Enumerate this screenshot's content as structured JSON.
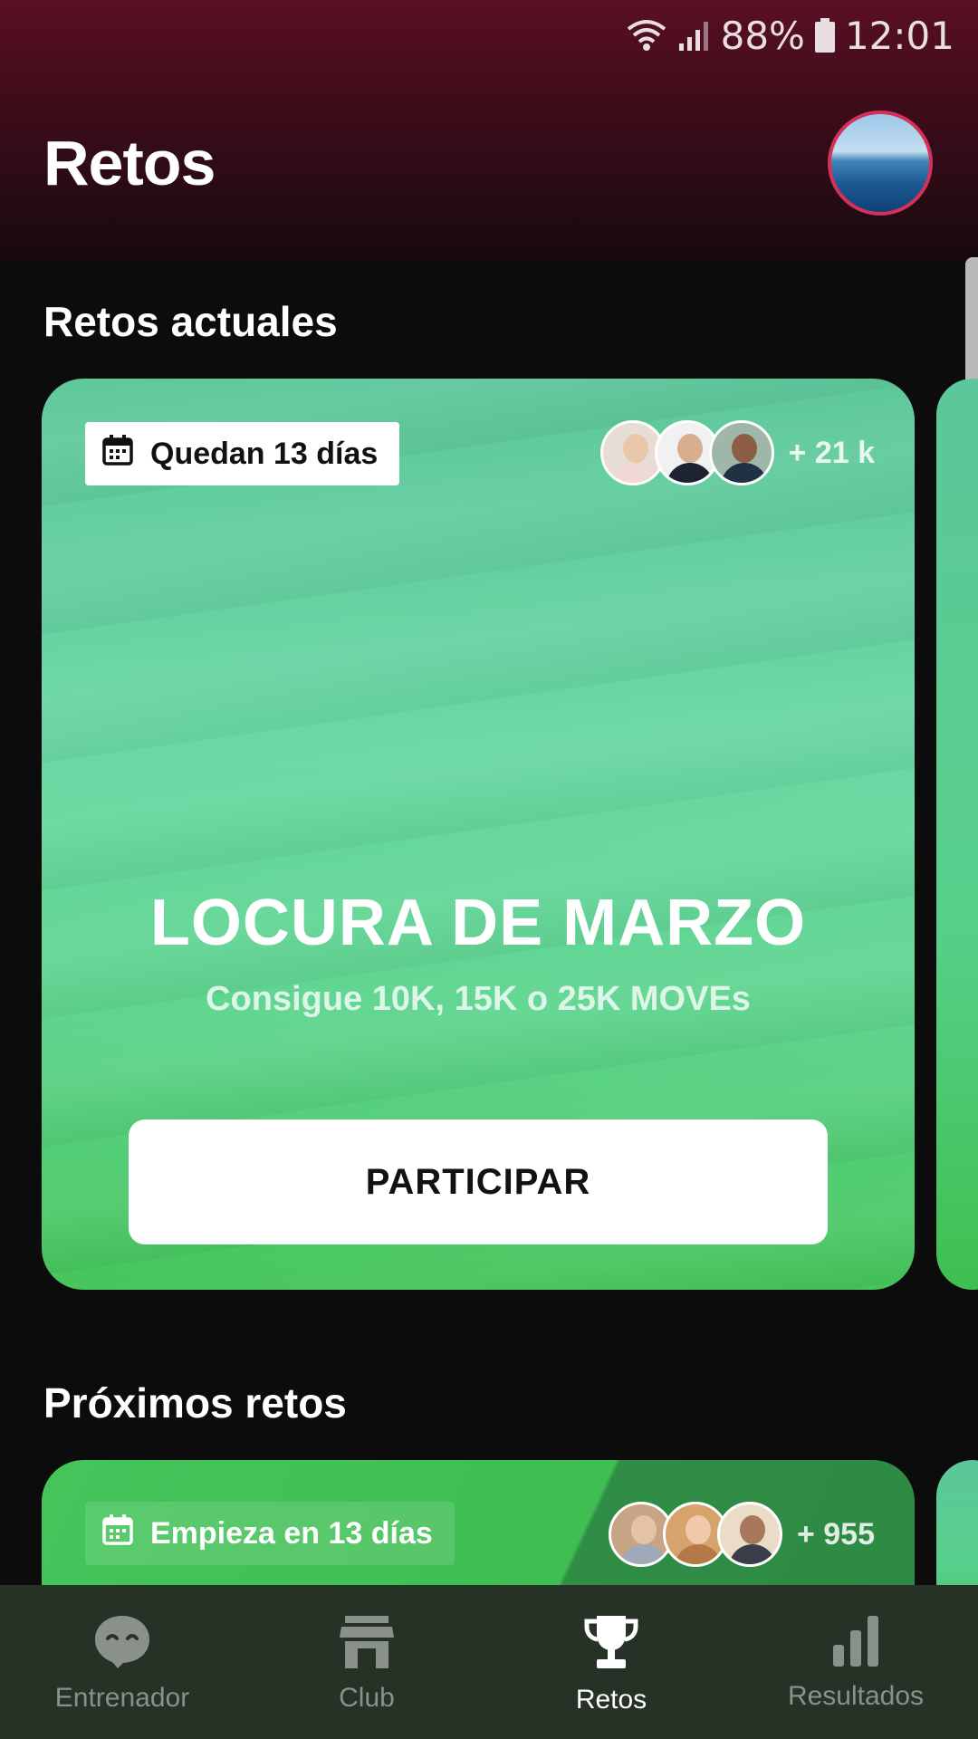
{
  "status_bar": {
    "battery": "88%",
    "time": "12:01"
  },
  "header": {
    "title": "Retos"
  },
  "sections": {
    "current_title": "Retos actuales",
    "upcoming_title": "Próximos retos"
  },
  "current_challenge": {
    "date_badge": "Quedan 13 días",
    "participants_count": "+ 21 k",
    "title": "LOCURA DE MARZO",
    "subtitle": "Consigue 10K, 15K o 25K MOVEs",
    "cta": "PARTICIPAR"
  },
  "upcoming_challenge": {
    "date_badge": "Empieza en 13 días",
    "participants_count": "+ 955"
  },
  "bottom_nav": [
    {
      "label": "Entrenador",
      "icon": "coach-icon",
      "active": false
    },
    {
      "label": "Club",
      "icon": "store-icon",
      "active": false
    },
    {
      "label": "Retos",
      "icon": "trophy-icon",
      "active": true
    },
    {
      "label": "Resultados",
      "icon": "bar-chart-icon",
      "active": false
    }
  ],
  "colors": {
    "header_top": "#5a0f24",
    "card_green": "#5fd58f",
    "nav_bg": "#253225",
    "avatar_border": "#d3305c"
  }
}
